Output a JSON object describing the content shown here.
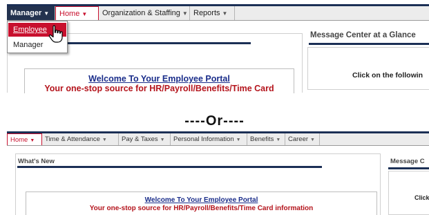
{
  "top": {
    "nav": [
      {
        "label": "Manager",
        "active": false
      },
      {
        "label": "Home",
        "active": true
      },
      {
        "label": "Organization & Staffing",
        "active": false
      },
      {
        "label": "Reports",
        "active": false
      }
    ],
    "dropdown": {
      "items": [
        {
          "label": "Employee",
          "highlighted": true
        },
        {
          "label": "Manager",
          "highlighted": false
        }
      ]
    },
    "message_center_title": "Message Center at a Glance",
    "message_center_click_text": "Click on the followin",
    "welcome_text": "Welcome To Your Employee Portal",
    "one_stop_text": "Your one-stop source for HR/Payroll/Benefits/Time Card"
  },
  "separator": "----Or----",
  "bottom": {
    "nav": [
      {
        "label": "Home",
        "active": true
      },
      {
        "label": "Time & Attendance",
        "active": false
      },
      {
        "label": "Pay & Taxes",
        "active": false
      },
      {
        "label": "Personal Information",
        "active": false
      },
      {
        "label": "Benefits",
        "active": false
      },
      {
        "label": "Career",
        "active": false
      }
    ],
    "whats_new": "What's New",
    "message_center_title": "Message C",
    "message_center_click_text": "Click",
    "welcome_text": "Welcome To Your Employee Portal",
    "one_stop_text": "Your one-stop source for HR/Payroll/Benefits/Time Card information"
  },
  "colors": {
    "navy": "#1b2f55",
    "manager_bg": "#23324f",
    "accent_red": "#c8102e",
    "welcome_blue": "#1a2d8a",
    "one_stop_red": "#b4141c"
  },
  "icons": {
    "caret": "caret-down-icon",
    "cursor": "hand-pointer-icon"
  }
}
